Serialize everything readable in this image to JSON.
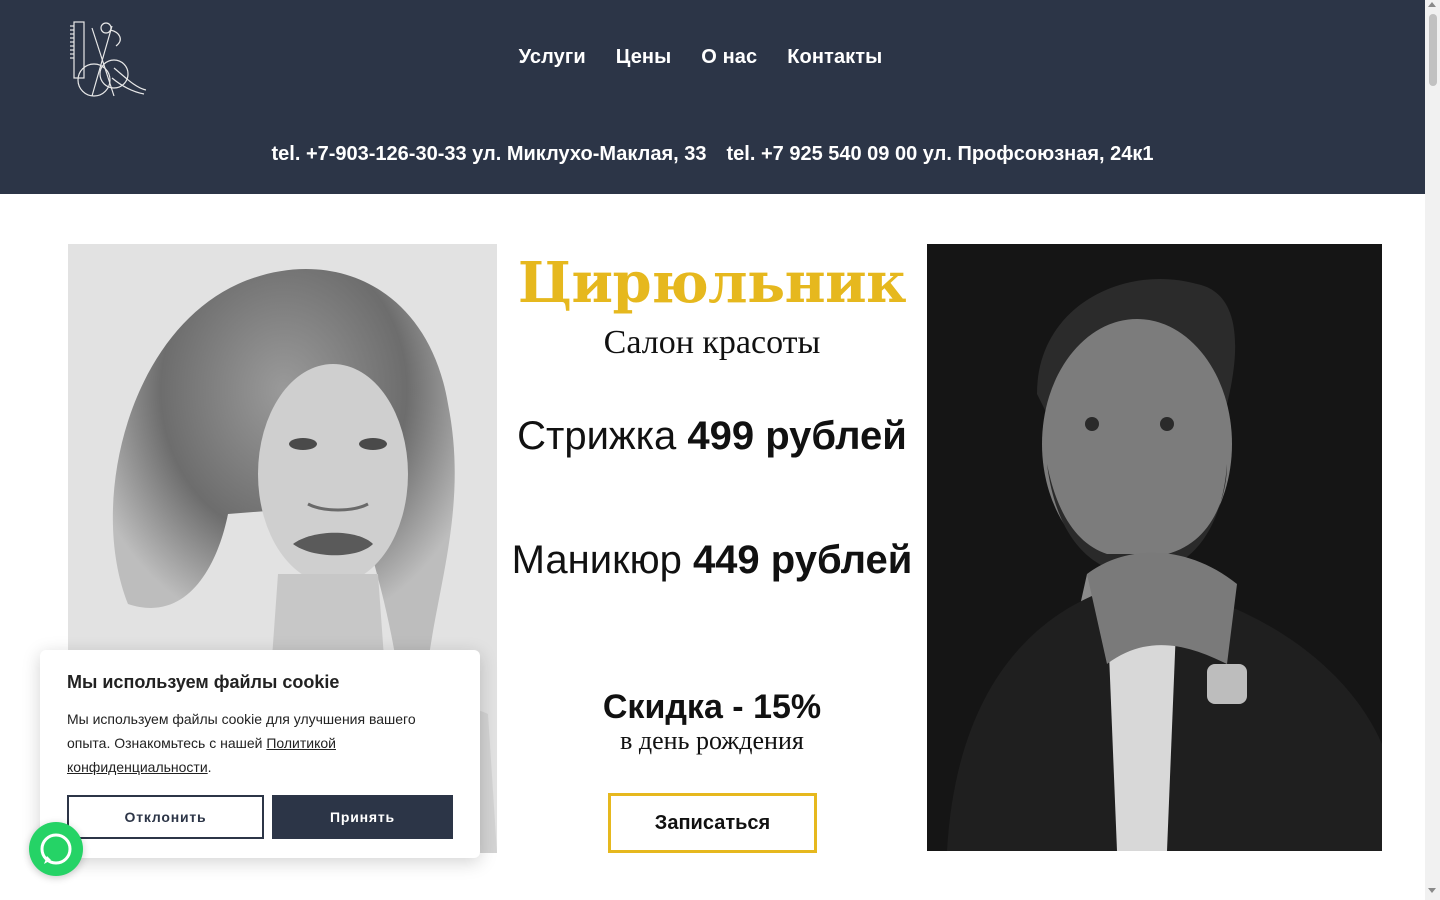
{
  "header": {
    "nav": [
      "Услуги",
      "Цены",
      "О нас",
      "Контакты"
    ],
    "contacts": [
      "tel. +7-903-126-30-33 ул. Миклухо-Маклая, 33",
      "tel. +7 925 540 09 00 ул. Профсоюзная, 24к1"
    ],
    "logo_icon": "scissors-comb-logo-icon"
  },
  "hero": {
    "brand": "Цирюльник",
    "brand_sub": "Салон красоты",
    "price_1_label": "Стрижка ",
    "price_1_value": "499 рублей",
    "price_2_label": "Маникюр ",
    "price_2_value": "449 рублей",
    "discount": "Скидка - 15%",
    "discount_sub": "в день рождения",
    "book_button": "Записаться",
    "photo_left": "woman-portrait-bw",
    "photo_right": "man-portrait-bw"
  },
  "cookie": {
    "title": "Мы используем файлы cookie",
    "text_before": "Мы используем файлы cookie для улучшения вашего опыта. Ознакомьтесь с нашей ",
    "link": "Политикой конфиденциальности",
    "text_after": ".",
    "decline": "Отклонить",
    "accept": "Принять"
  },
  "colors": {
    "header_bg": "#2c3547",
    "accent_gold": "#e6b81e",
    "whatsapp": "#25d366"
  },
  "floating": {
    "whatsapp_icon": "whatsapp-icon"
  }
}
